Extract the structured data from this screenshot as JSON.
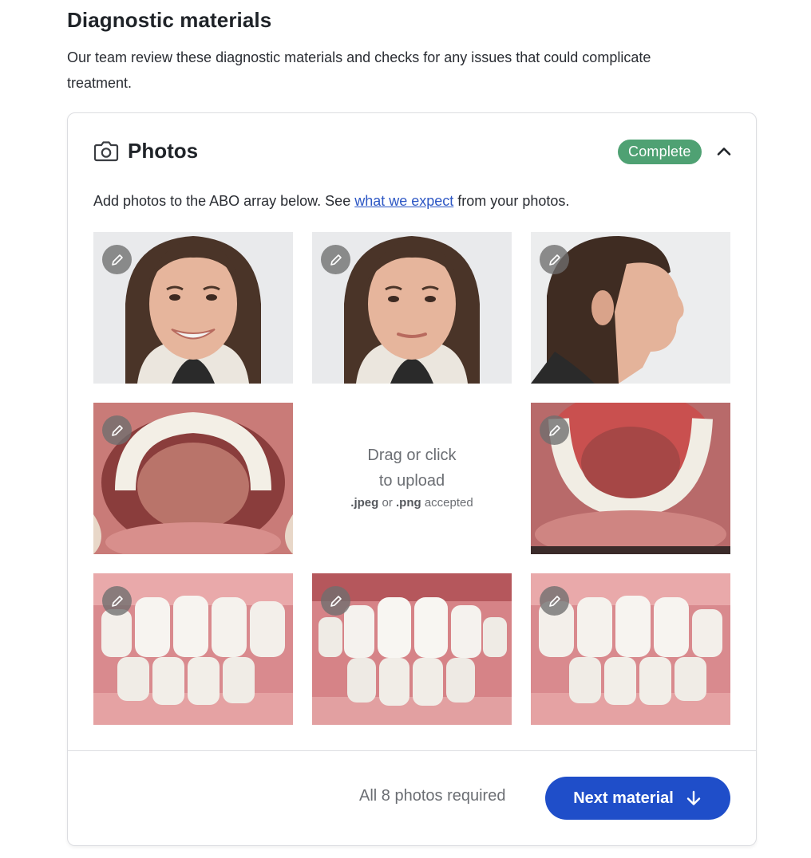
{
  "section": {
    "title": "Diagnostic materials",
    "description": "Our team review these diagnostic materials and checks for any issues that could complicate treatment."
  },
  "card": {
    "title": "Photos",
    "icon": "camera-icon",
    "status": "Complete",
    "status_color": "#4fa173",
    "collapse_icon": "chevron-up-icon",
    "intro_before": "Add photos to the ABO array below. See ",
    "intro_link": "what we expect",
    "intro_after": " from your photos."
  },
  "upload": {
    "line1": "Drag or click",
    "line2": "to upload",
    "ext1": ".jpeg",
    "or": " or ",
    "ext2": ".png",
    "accepted": " accepted"
  },
  "footer": {
    "note": "All 8 photos required",
    "next_label": "Next material",
    "next_icon": "arrow-down-icon",
    "accent": "#1f4ec9"
  }
}
